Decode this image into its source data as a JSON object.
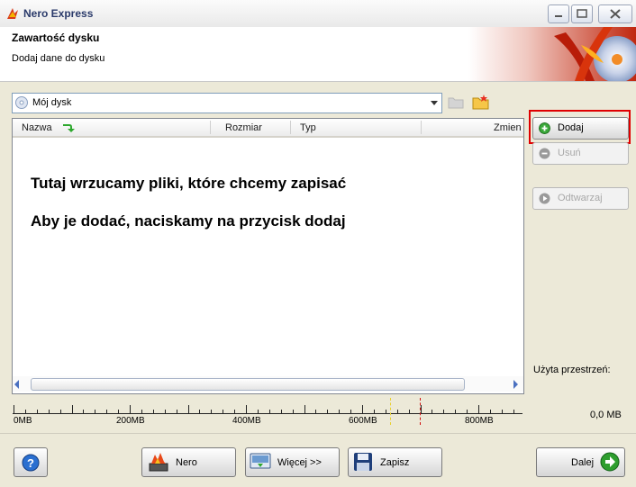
{
  "window": {
    "title": "Nero Express"
  },
  "header": {
    "title": "Zawartość dysku",
    "subtitle": "Dodaj dane do dysku"
  },
  "compilation": {
    "selected": "Mój dysk"
  },
  "file_list": {
    "columns": [
      "Nazwa",
      "Rozmiar",
      "Typ",
      "Zmien"
    ],
    "message_line1": "Tutaj wrzucamy pliki, które chcemy zapisać",
    "message_line2": "Aby je dodać, naciskamy na przycisk dodaj"
  },
  "actions": {
    "add": "Dodaj",
    "remove": "Usuń",
    "play": "Odtwarzaj"
  },
  "space": {
    "label": "Użyta przestrzeń:",
    "value": "0,0 MB"
  },
  "ruler": {
    "labels": [
      "0MB",
      "200MB",
      "400MB",
      "600MB",
      "800MB"
    ]
  },
  "footer": {
    "nero": "Nero",
    "more": "Więcej >>",
    "save": "Zapisz",
    "next": "Dalej"
  },
  "colors": {
    "highlight": "#e00000",
    "add_icon": "#3aa83a",
    "next_icon": "#2e9e2e",
    "help_icon": "#2a6fd0"
  }
}
